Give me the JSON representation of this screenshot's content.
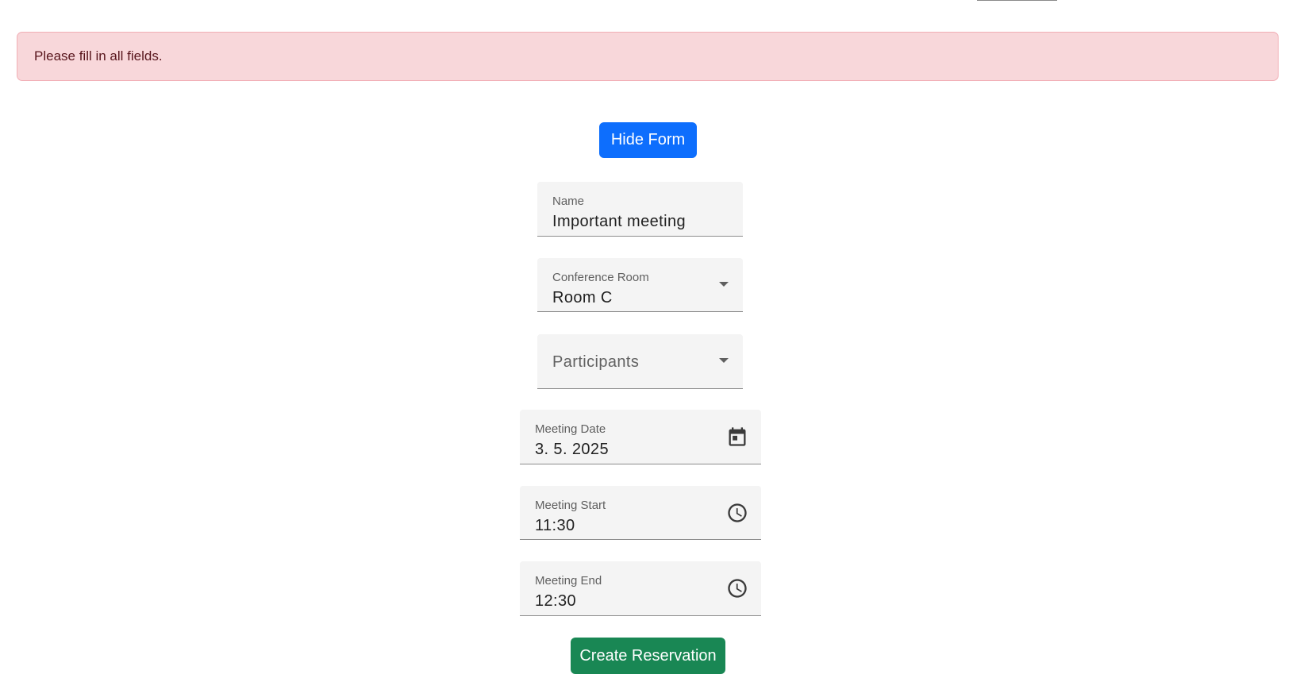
{
  "alert": {
    "message": "Please fill in all fields."
  },
  "toggle_button": {
    "label": "Hide Form",
    "color": "#0d6efd"
  },
  "form": {
    "name": {
      "label": "Name",
      "value": "Important meeting"
    },
    "conference_room": {
      "label": "Conference Room",
      "value": "Room C",
      "icon": "arrow-drop-down-icon"
    },
    "participants": {
      "placeholder": "Participants",
      "icon": "arrow-drop-down-icon"
    },
    "meeting_date": {
      "label": "Meeting Date",
      "value": "3. 5. 2025",
      "icon": "calendar-icon"
    },
    "meeting_start": {
      "label": "Meeting Start",
      "value": "11:30",
      "icon": "clock-icon"
    },
    "meeting_end": {
      "label": "Meeting End",
      "value": "12:30",
      "icon": "clock-icon"
    }
  },
  "submit_button": {
    "label": "Create Reservation",
    "color": "#198754"
  },
  "colors": {
    "alert_background": "#f8d7da",
    "alert_text": "#58151c",
    "field_background": "#f4f4f4"
  }
}
